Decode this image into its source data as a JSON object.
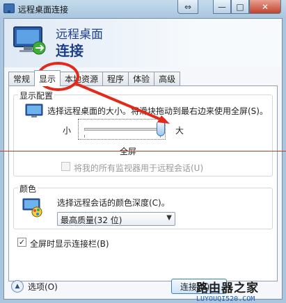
{
  "window": {
    "title": "远程桌面连接",
    "nav_symbol": "⇔",
    "min_symbol": "—",
    "max_symbol": "□",
    "close_symbol": "✕"
  },
  "header": {
    "line1": "远程桌面",
    "line2": "连接",
    "icon": "monitor-connect-icon"
  },
  "tabs": [
    {
      "label": "常规",
      "active": false
    },
    {
      "label": "显示",
      "active": true
    },
    {
      "label": "本地资源",
      "active": false
    },
    {
      "label": "程序",
      "active": false
    },
    {
      "label": "体验",
      "active": false
    },
    {
      "label": "高级",
      "active": false
    }
  ],
  "display_config": {
    "group_label": "显示配置",
    "description": "选择远程桌面的大小。将滑块拖动到最右边来使用全屏(S)。",
    "slider_min_label": "小",
    "slider_max_label": "大",
    "slider_value": 1.0,
    "slider_value_text": "全屏",
    "multimon_label": "将我的所有监视器用于远程会话(U)",
    "multimon_checked": false,
    "multimon_disabled": true
  },
  "colors_group": {
    "group_label": "颜色",
    "description": "选择远程会话的颜色深度(C)。",
    "selected": "最高质量(32 位)",
    "arrow": "▼"
  },
  "fullscreen_bar": {
    "label": "全屏时显示连接栏(B)",
    "checked": true,
    "check_mark": "✓"
  },
  "footer": {
    "options_icon": "▲",
    "options_label": "选项(O)",
    "connect_label": "连接(N)"
  },
  "watermark": {
    "title": "路由器之家",
    "url": "LUYOUQI520.COM"
  },
  "colors": {
    "annotation_red": "#e12a1a",
    "header_blue": "#1e3f8a"
  }
}
